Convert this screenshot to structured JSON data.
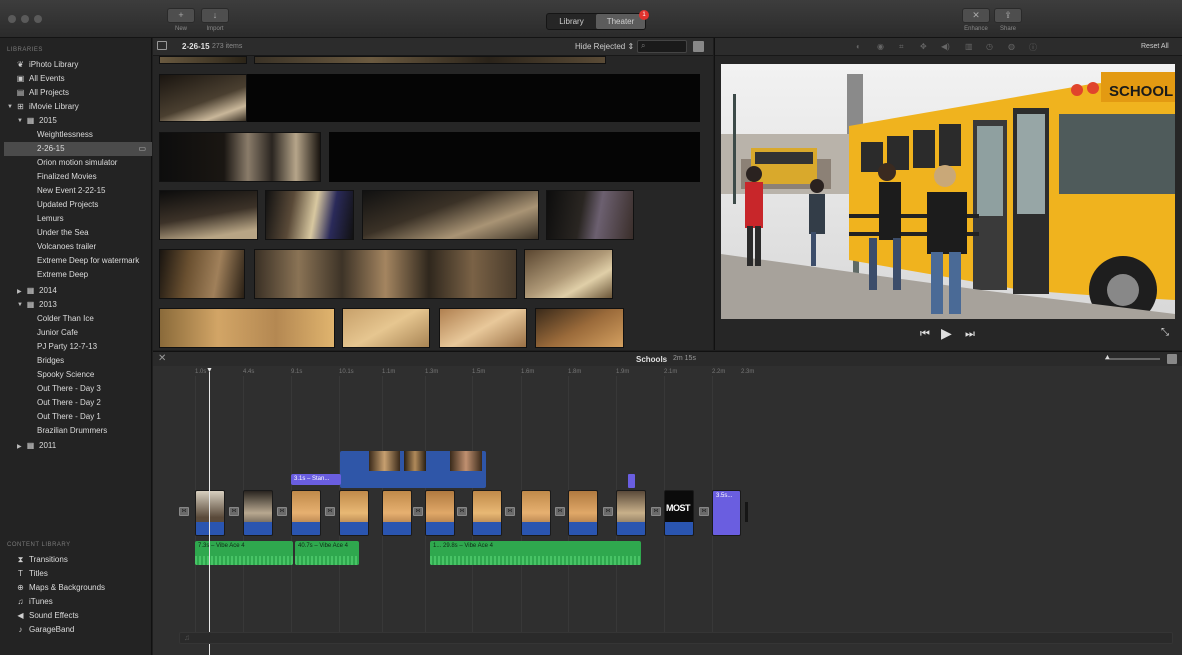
{
  "toolbar": {
    "new_label": "New",
    "import_label": "Import",
    "library_tab": "Library",
    "theater_tab": "Theater",
    "theater_badge": "1",
    "enhance_label": "Enhance",
    "share_label": "Share"
  },
  "sidebar": {
    "libraries_header": "LIBRARIES",
    "items": [
      {
        "label": "iPhoto Library",
        "icon": "photo-icon"
      },
      {
        "label": "All Events",
        "icon": "star-icon"
      },
      {
        "label": "All Projects",
        "icon": "film-icon"
      },
      {
        "label": "iMovie Library",
        "icon": "grid-icon"
      },
      {
        "label": "2015",
        "icon": "calendar-icon"
      },
      {
        "label": "Weightlessness"
      },
      {
        "label": "2-26-15"
      },
      {
        "label": "Orion motion simulator"
      },
      {
        "label": "Finalized Movies"
      },
      {
        "label": "New Event 2-22-15"
      },
      {
        "label": "Updated Projects"
      },
      {
        "label": "Lemurs"
      },
      {
        "label": "Under the Sea"
      },
      {
        "label": "Volcanoes trailer"
      },
      {
        "label": "Extreme Deep for watermark"
      },
      {
        "label": "Extreme Deep"
      },
      {
        "label": "2014",
        "icon": "calendar-icon"
      },
      {
        "label": "2013",
        "icon": "calendar-icon"
      },
      {
        "label": "Colder Than Ice"
      },
      {
        "label": "Junior Cafe"
      },
      {
        "label": "PJ Party 12-7-13"
      },
      {
        "label": "Bridges"
      },
      {
        "label": "Spooky Science"
      },
      {
        "label": "Out There - Day 3"
      },
      {
        "label": "Out There - Day 2"
      },
      {
        "label": "Out There - Day 1"
      },
      {
        "label": "Brazilian Drummers"
      },
      {
        "label": "2011",
        "icon": "calendar-icon"
      }
    ],
    "content_header": "CONTENT LIBRARY",
    "content_items": [
      {
        "label": "Transitions",
        "icon": "transitions-icon"
      },
      {
        "label": "Titles",
        "icon": "titles-icon"
      },
      {
        "label": "Maps & Backgrounds",
        "icon": "globe-icon"
      },
      {
        "label": "iTunes",
        "icon": "music-note-icon"
      },
      {
        "label": "Sound Effects",
        "icon": "speaker-icon"
      },
      {
        "label": "GarageBand",
        "icon": "guitar-icon"
      }
    ]
  },
  "browser": {
    "event_name": "2-26-15",
    "item_count": "273 items",
    "filter": "Hide Rejected ⇕"
  },
  "viewer": {
    "reset_label": "Reset All",
    "bus_sign": "SCHOOL BUS"
  },
  "timeline": {
    "project_name": "Schools",
    "duration": "2m 15s",
    "ticks": [
      "1.0s",
      "4.4s",
      "9.1s",
      "10.1s",
      "1.1m",
      "1.3m",
      "1.5m",
      "1.6m",
      "1.8m",
      "1.9m",
      "2.1m",
      "2.2m",
      "2.3m"
    ],
    "cutaway_label": "3.1s – Stan...",
    "title_clip_label": "3.5s...",
    "most_label": "MOST",
    "audio_clips": [
      {
        "label": "7.3s – Vibe Ace 4"
      },
      {
        "label": "40.7s – Vibe Ace 4"
      },
      {
        "label": "1...  29.8s – Vibe Ace 4"
      }
    ]
  },
  "colors": {
    "accent": "#2fa84e",
    "clip_audio_blue": "#2a55b0",
    "title_purple": "#6a5ee0",
    "badge_red": "#e0332e"
  }
}
